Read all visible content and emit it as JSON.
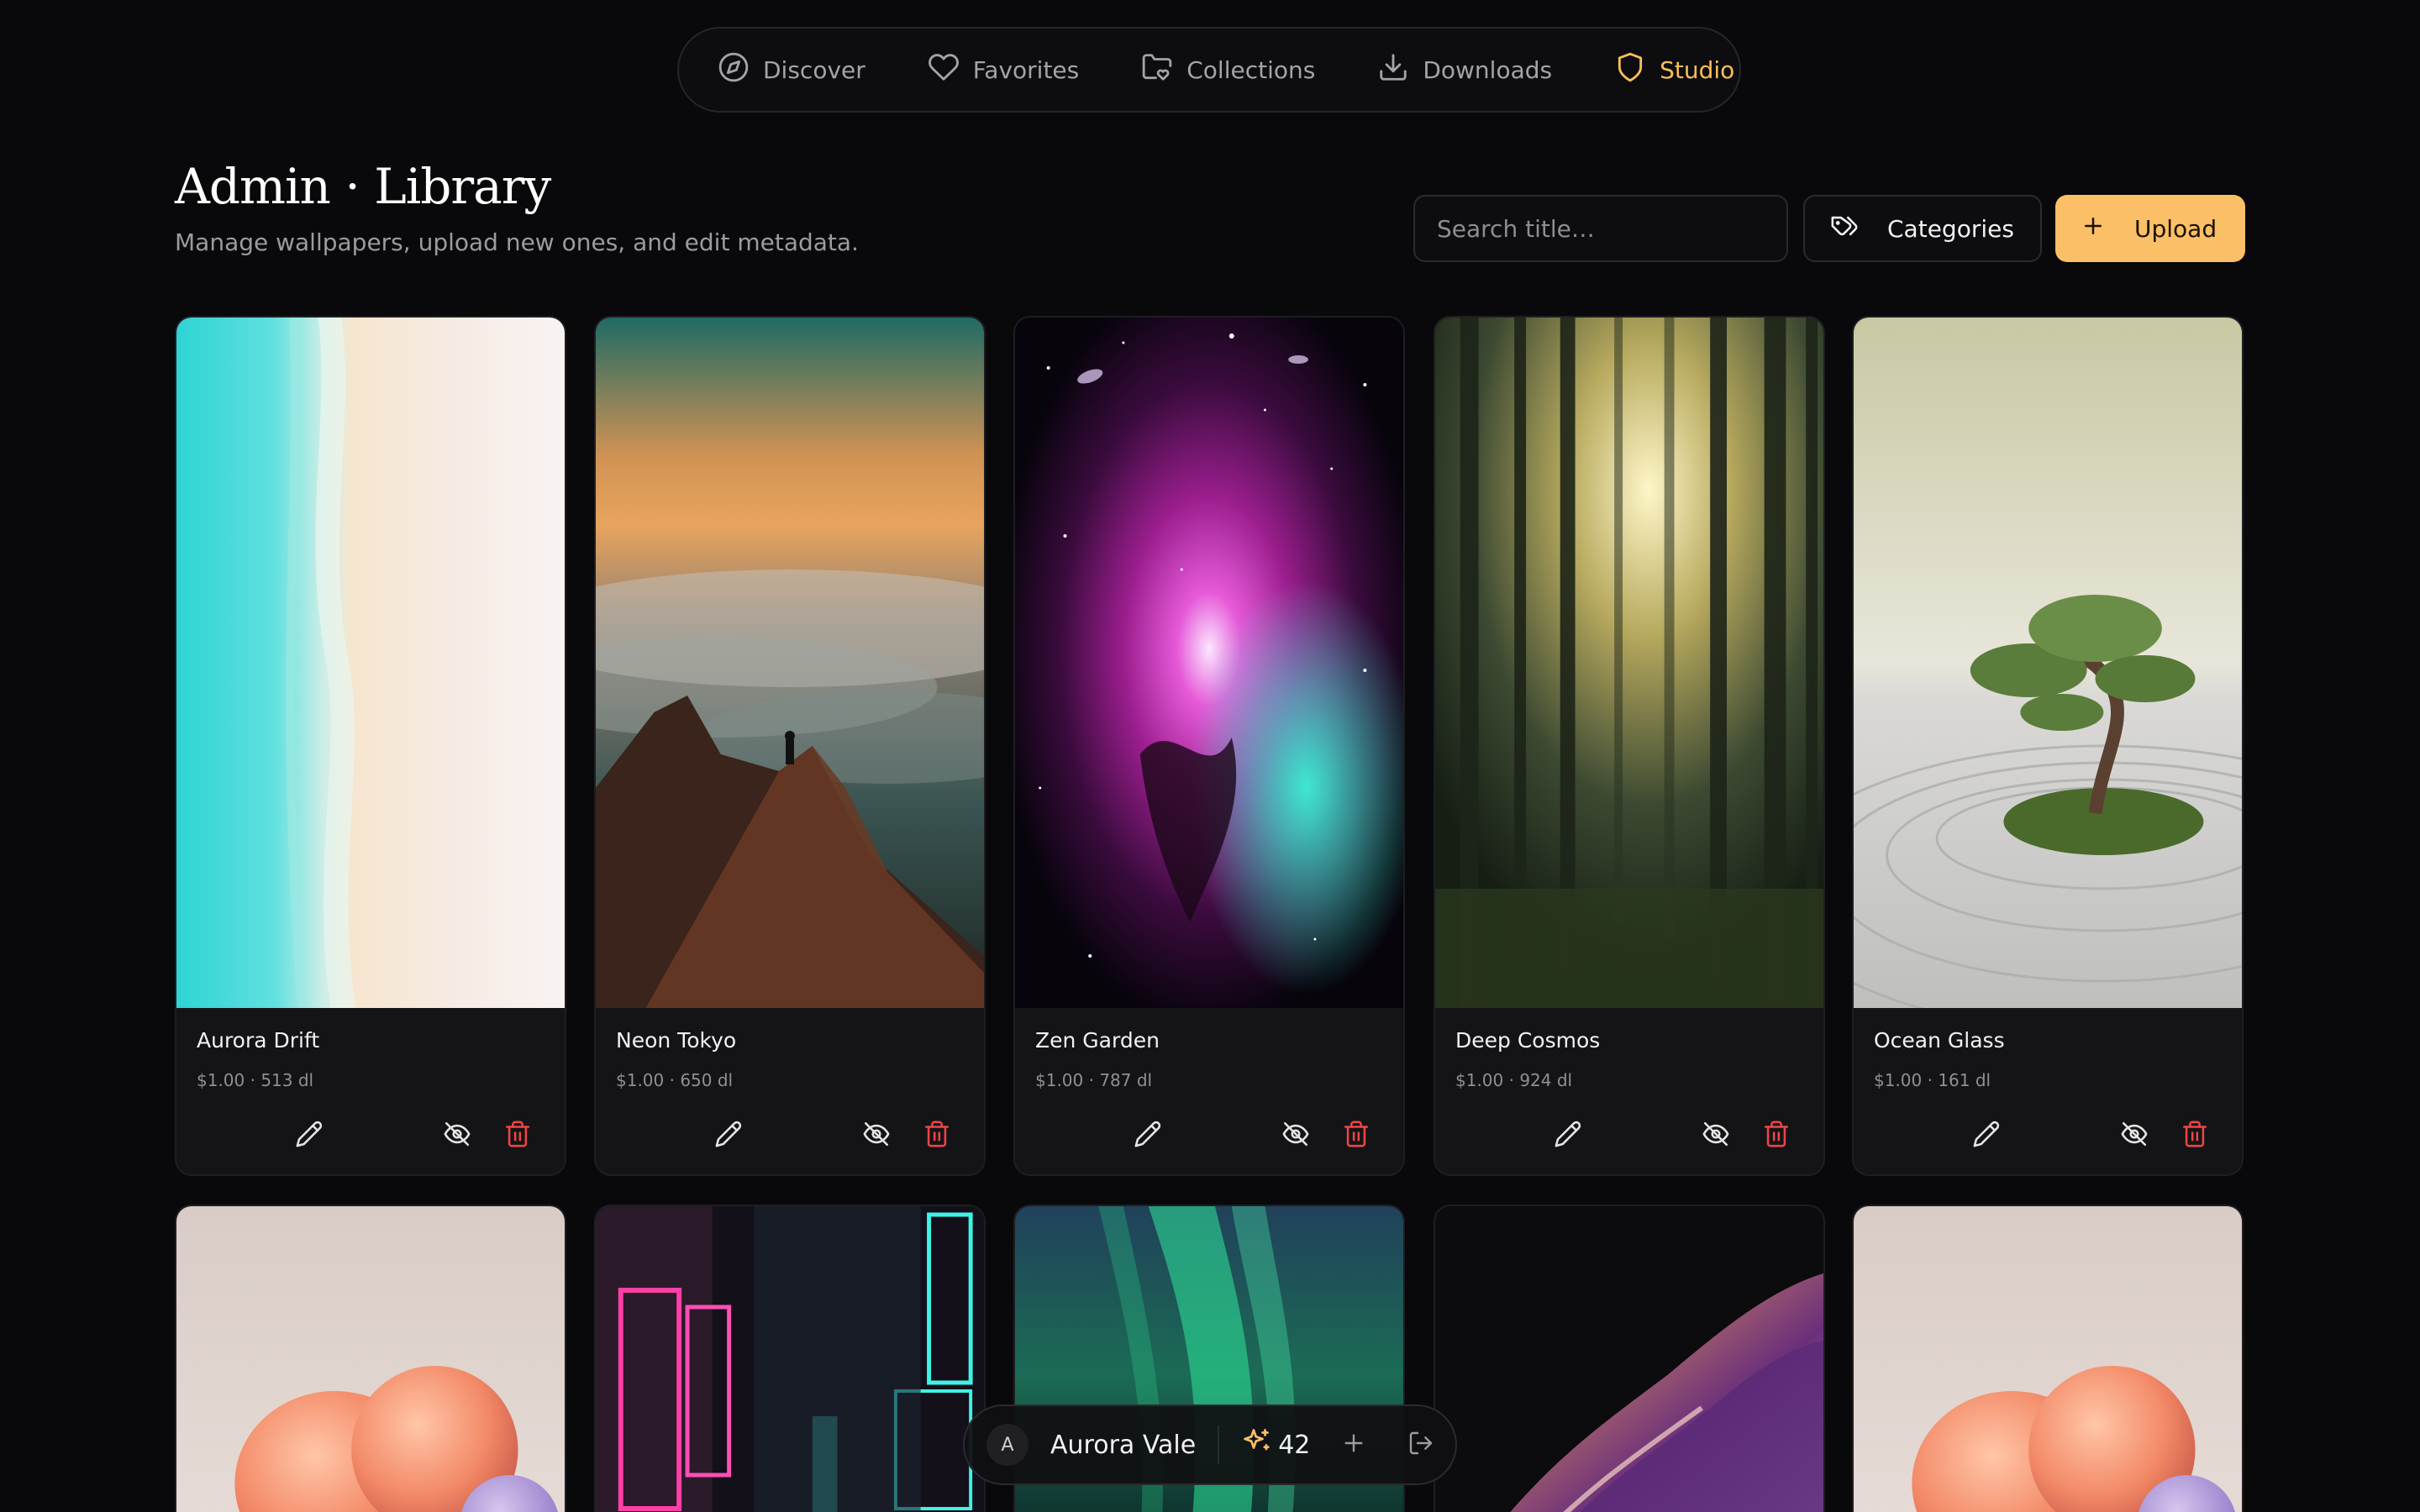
{
  "nav": {
    "items": [
      {
        "label": "Discover",
        "icon": "compass-icon"
      },
      {
        "label": "Favorites",
        "icon": "heart-icon"
      },
      {
        "label": "Collections",
        "icon": "folder-heart-icon"
      },
      {
        "label": "Downloads",
        "icon": "download-icon"
      },
      {
        "label": "Studio",
        "icon": "shield-icon",
        "active": true
      }
    ]
  },
  "header": {
    "title": "Admin · Library",
    "subtitle": "Manage wallpapers, upload new ones, and edit metadata."
  },
  "toolbar": {
    "search_placeholder": "Search title…",
    "categories_label": "Categories",
    "upload_label": "Upload"
  },
  "wallpapers": [
    {
      "title": "Aurora Drift",
      "meta": "$1.00 · 513 dl",
      "image": "beach-aerial"
    },
    {
      "title": "Neon Tokyo",
      "meta": "$1.00 · 650 dl",
      "image": "mountain-sea-of-clouds"
    },
    {
      "title": "Zen Garden",
      "meta": "$1.00 · 787 dl",
      "image": "nebula-galaxy"
    },
    {
      "title": "Deep Cosmos",
      "meta": "$1.00 · 924 dl",
      "image": "misty-forest"
    },
    {
      "title": "Ocean Glass",
      "meta": "$1.00 · 161 dl",
      "image": "bonsai-zen-sand"
    }
  ],
  "wallpapers_row2": [
    {
      "image": "pastel-3d-blob"
    },
    {
      "image": "neon-street-signs"
    },
    {
      "image": "aurora-borealis"
    },
    {
      "image": "liquid-metal-wave"
    },
    {
      "image": "pastel-3d-blob"
    }
  ],
  "user": {
    "initial": "A",
    "name": "Aurora Vale",
    "credits": "42"
  },
  "colors": {
    "accent": "#fbbf67",
    "danger": "#ef4444",
    "background": "#09090b"
  }
}
